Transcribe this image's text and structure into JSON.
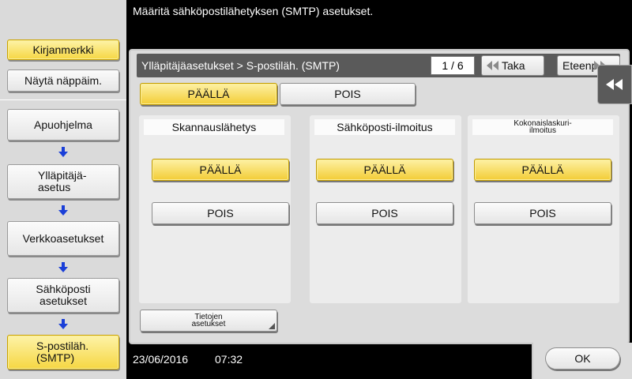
{
  "message": "Määritä sähköpostilähetyksen (SMTP) asetukset.",
  "sidebar": {
    "bookmark": "Kirjanmerkki",
    "show_keypad": "Näytä näppäim.",
    "breadcrumb": [
      "Apuohjelma",
      "Ylläpitäjä-\nasetus",
      "Verkkoasetukset",
      "Sähköposti\nasetukset",
      "S-postiläh.\n(SMTP)"
    ]
  },
  "header": {
    "title": "Ylläpitäjäasetukset > S-postiläh. (SMTP)",
    "page": "1 / 6",
    "back": "Taka",
    "forward": "Eteenp"
  },
  "main_toggle": {
    "on": "PÄÄLLÄ",
    "off": "POIS",
    "selected": "on"
  },
  "columns": [
    {
      "title": "Skannauslähetys",
      "on": "PÄÄLLÄ",
      "off": "POIS",
      "selected": "on"
    },
    {
      "title": "Sähköposti-ilmoitus",
      "on": "PÄÄLLÄ",
      "off": "POIS",
      "selected": "on"
    },
    {
      "title": "Kokonaislaskuri-\nilmoitus",
      "on": "PÄÄLLÄ",
      "off": "POIS",
      "selected": "on"
    }
  ],
  "details_button": "Tietojen\nasetukset",
  "footer": {
    "date": "23/06/2016",
    "time": "07:32",
    "ok": "OK"
  },
  "colors": {
    "selected": "#f3cd36",
    "arrow": "#1a3fd8",
    "title_bar": "#5a5a5a"
  },
  "icons": [
    "down-arrow-icon",
    "double-left-arrow-icon",
    "double-right-arrow-icon",
    "collapse-icon"
  ]
}
